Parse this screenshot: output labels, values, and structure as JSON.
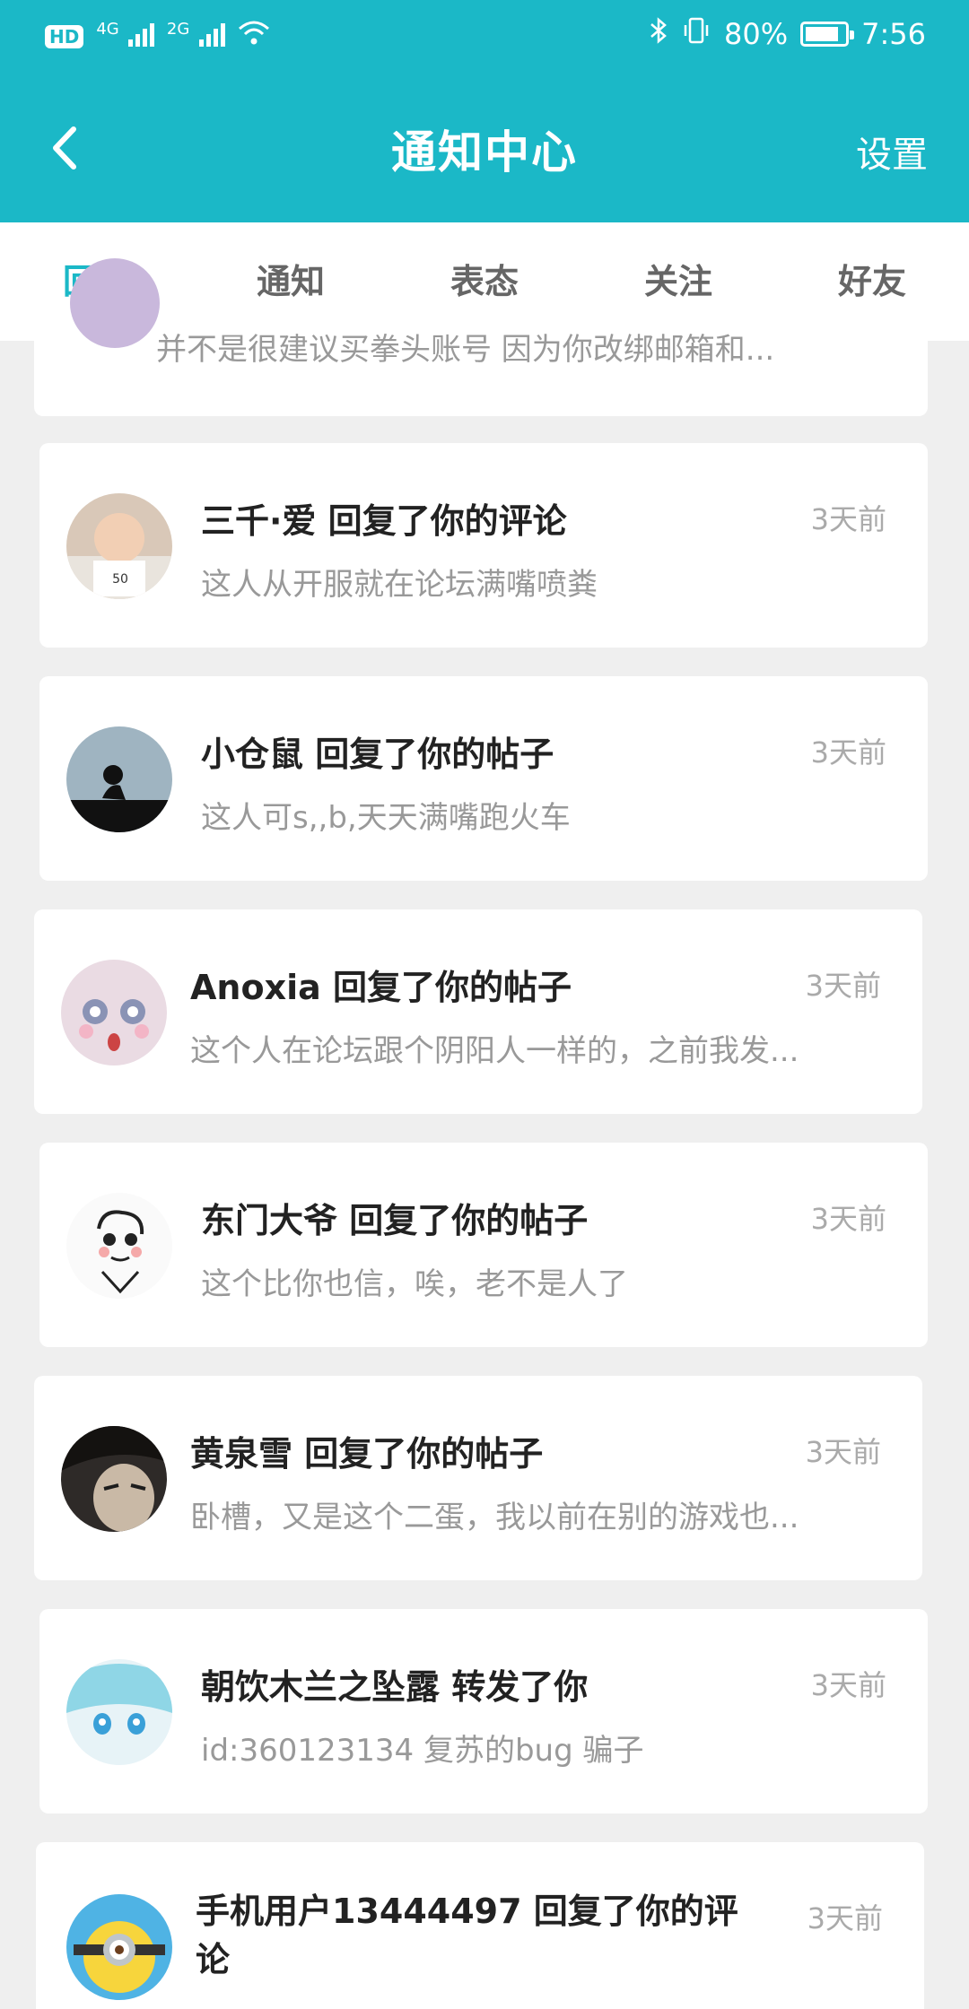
{
  "status": {
    "hd": "HD",
    "net1": "4G",
    "net2": "2G",
    "battery_pct": "80%",
    "time": "7:56"
  },
  "header": {
    "title": "通知中心",
    "settings": "设置"
  },
  "tabs": [
    {
      "label": "回复",
      "active": true
    },
    {
      "label": "通知",
      "active": false
    },
    {
      "label": "表态",
      "active": false
    },
    {
      "label": "关注",
      "active": false
    },
    {
      "label": "好友",
      "active": false
    }
  ],
  "partial_item": {
    "subtitle": "并不是很建议买拳头账号 因为你改绑邮箱和..."
  },
  "items": [
    {
      "title": "三千·爱 回复了你的评论",
      "subtitle": "这人从开服就在论坛满嘴喷粪",
      "time": "3天前",
      "avatar": "avatar-child"
    },
    {
      "title": "小仓鼠 回复了你的帖子",
      "subtitle": "这人可s,,b,天天满嘴跑火车",
      "time": "3天前",
      "avatar": "avatar-silhouette"
    },
    {
      "title": "Anoxia 回复了你的帖子",
      "subtitle": "这个人在论坛跟个阴阳人一样的，之前我发...",
      "time": "3天前",
      "avatar": "avatar-anime-girl"
    },
    {
      "title": "东门大爷 回复了你的帖子",
      "subtitle": "这个比你也信，唉，老不是人了",
      "time": "3天前",
      "avatar": "avatar-cartoon-boy"
    },
    {
      "title": "黄泉雪 回复了你的帖子",
      "subtitle": "卧槽，又是这个二蛋，我以前在别的游戏也...",
      "time": "3天前",
      "avatar": "avatar-dark-anime"
    },
    {
      "title": "朝饮木兰之坠露 转发了你",
      "subtitle": "id:360123134   复苏的bug 骗子",
      "time": "3天前",
      "avatar": "avatar-blue-hair"
    },
    {
      "title": "手机用户13444497 回复了你的评论",
      "subtitle": "",
      "time": "3天前",
      "avatar": "avatar-minion"
    }
  ],
  "colors": {
    "accent": "#1bb8c7",
    "background": "#efefef"
  }
}
